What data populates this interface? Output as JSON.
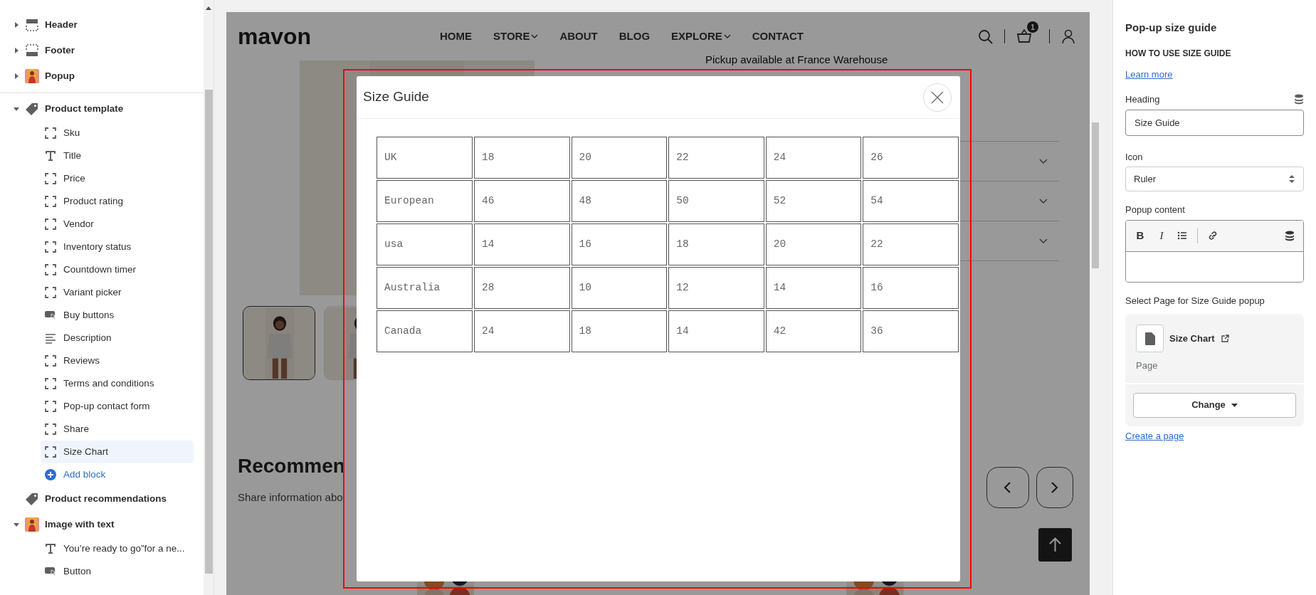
{
  "sidebar": {
    "groups": [
      {
        "sections": [
          {
            "label": "Header",
            "kind": "header",
            "expanded": false
          },
          {
            "label": "Footer",
            "kind": "footer",
            "expanded": false
          },
          {
            "label": "Popup",
            "expanded": false
          }
        ]
      },
      {
        "sections": [
          {
            "label": "Product template",
            "kind": "tag",
            "expanded": true,
            "children": [
              {
                "label": "Sku",
                "kind": "block",
                "selected": false
              },
              {
                "label": "Title",
                "kind": "text",
                "selected": false
              },
              {
                "label": "Price",
                "kind": "block",
                "selected": false
              },
              {
                "label": "Product rating",
                "kind": "block",
                "selected": false
              },
              {
                "label": "Vendor",
                "kind": "block",
                "selected": false
              },
              {
                "label": "Inventory status",
                "kind": "block",
                "selected": false
              },
              {
                "label": "Countdown timer",
                "kind": "block",
                "selected": false
              },
              {
                "label": "Variant picker",
                "kind": "block",
                "selected": false
              },
              {
                "label": "Buy buttons",
                "kind": "button",
                "selected": false
              },
              {
                "label": "Description",
                "kind": "lines",
                "selected": false
              },
              {
                "label": "Reviews",
                "kind": "block",
                "selected": false
              },
              {
                "label": "Terms and conditions",
                "kind": "block",
                "selected": false
              },
              {
                "label": "Pop-up contact form",
                "kind": "block",
                "selected": false
              },
              {
                "label": "Share",
                "kind": "block",
                "selected": false
              },
              {
                "label": "Size Chart",
                "kind": "block",
                "selected": true
              },
              {
                "label": "Add block",
                "kind": "add",
                "selected": false
              }
            ]
          },
          {
            "label": "Product recommendations",
            "kind": "tag"
          },
          {
            "label": "Image with text",
            "expanded": true,
            "children": [
              {
                "label": "You’re ready to go”for a ne...",
                "kind": "text",
                "selected": false
              },
              {
                "label": "Button",
                "kind": "button",
                "selected": false
              }
            ]
          }
        ]
      }
    ]
  },
  "preview": {
    "logo": "mavon",
    "nav": [
      {
        "label": "HOME",
        "dropdown": false
      },
      {
        "label": "STORE",
        "dropdown": true
      },
      {
        "label": "ABOUT",
        "dropdown": false
      },
      {
        "label": "BLOG",
        "dropdown": false
      },
      {
        "label": "EXPLORE",
        "dropdown": true
      },
      {
        "label": "CONTACT",
        "dropdown": false
      }
    ],
    "cart_count": "1",
    "pickup": "Pickup available at France Warehouse",
    "section_heading": "Recommen",
    "section_text": "Share information abo",
    "modal": {
      "title": "Size Guide",
      "rows": [
        [
          "UK",
          "18",
          "20",
          "22",
          "24",
          "26"
        ],
        [
          "European",
          "46",
          "48",
          "50",
          "52",
          "54"
        ],
        [
          "usa",
          "14",
          "16",
          "18",
          "20",
          "22"
        ],
        [
          "Australia",
          "28",
          "10",
          "12",
          "14",
          "16"
        ],
        [
          "Canada",
          "24",
          "18",
          "14",
          "42",
          "36"
        ]
      ]
    }
  },
  "settings": {
    "title": "Pop-up size guide",
    "subheading": "HOW TO USE SIZE GUIDE",
    "learn_more": "Learn more",
    "heading": {
      "label": "Heading",
      "value": "Size Guide"
    },
    "icon": {
      "label": "Icon",
      "value": "Ruler"
    },
    "popup_content": {
      "label": "Popup content",
      "toolbar": [
        "B",
        "I"
      ]
    },
    "page": {
      "label": "Select Page for Size Guide popup",
      "name": "Size Chart",
      "type": "Page",
      "button": "Change"
    },
    "create_link": "Create a page"
  }
}
